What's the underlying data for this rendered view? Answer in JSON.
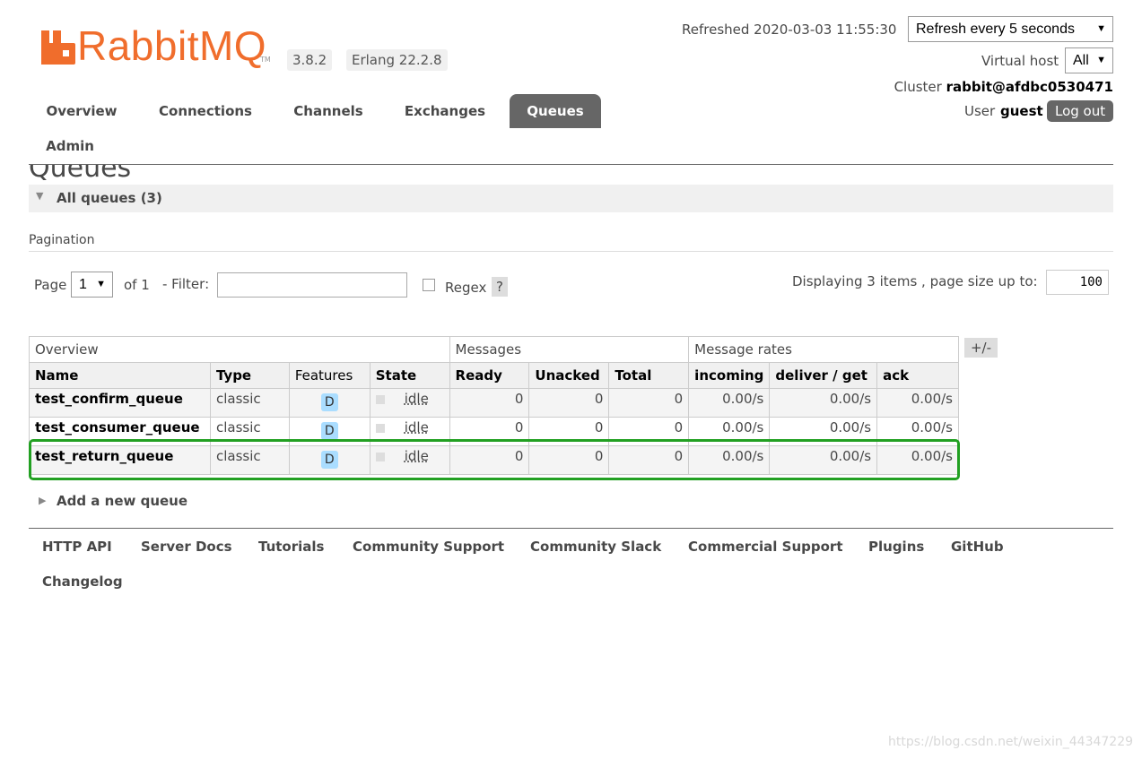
{
  "header": {
    "logo_text": "RabbitMQ",
    "logo_tm": "TM",
    "version": "3.8.2",
    "erlang": "Erlang 22.2.8",
    "refreshed": "Refreshed 2020-03-03 11:55:30",
    "refresh_select": "Refresh every 5 seconds",
    "vhost_label": "Virtual host",
    "vhost_value": "All",
    "cluster_label": "Cluster",
    "cluster_value": "rabbit@afdbc0530471",
    "user_label": "User",
    "user_value": "guest",
    "logout": "Log out"
  },
  "nav": {
    "tabs": [
      "Overview",
      "Connections",
      "Channels",
      "Exchanges",
      "Queues",
      "Admin"
    ],
    "active": "Queues"
  },
  "page": {
    "title": "Queues",
    "section": "All queues (3)",
    "pagination_label": "Pagination",
    "page_label": "Page",
    "page_value": "1",
    "of_label": "of 1",
    "filter_label": "- Filter:",
    "filter_value": "",
    "regex_label": "Regex",
    "help": "?",
    "displaying": "Displaying 3 items , page size up to:",
    "page_size": "100",
    "plus_minus": "+/-",
    "add_queue": "Add a new queue"
  },
  "table": {
    "groups": [
      "Overview",
      "Messages",
      "Message rates"
    ],
    "columns": [
      "Name",
      "Type",
      "Features",
      "State",
      "Ready",
      "Unacked",
      "Total",
      "incoming",
      "deliver / get",
      "ack"
    ],
    "rows": [
      {
        "name": "test_confirm_queue",
        "type": "classic",
        "feature": "D",
        "state": "idle",
        "ready": "0",
        "unacked": "0",
        "total": "0",
        "incoming": "0.00/s",
        "deliver": "0.00/s",
        "ack": "0.00/s"
      },
      {
        "name": "test_consumer_queue",
        "type": "classic",
        "feature": "D",
        "state": "idle",
        "ready": "0",
        "unacked": "0",
        "total": "0",
        "incoming": "0.00/s",
        "deliver": "0.00/s",
        "ack": "0.00/s"
      },
      {
        "name": "test_return_queue",
        "type": "classic",
        "feature": "D",
        "state": "idle",
        "ready": "0",
        "unacked": "0",
        "total": "0",
        "incoming": "0.00/s",
        "deliver": "0.00/s",
        "ack": "0.00/s"
      }
    ]
  },
  "footer": {
    "links": [
      "HTTP API",
      "Server Docs",
      "Tutorials",
      "Community Support",
      "Community Slack",
      "Commercial Support",
      "Plugins",
      "GitHub",
      "Changelog"
    ]
  },
  "watermark": "https://blog.csdn.net/weixin_44347229",
  "colors": {
    "brand": "#f06d2c",
    "highlight": "#22a022",
    "active_tab": "#666666"
  }
}
